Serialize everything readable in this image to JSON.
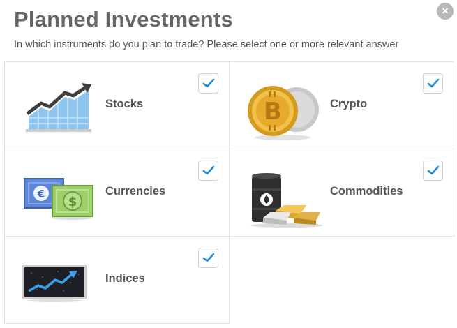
{
  "dialog": {
    "title": "Planned Investments",
    "subtitle": "In which instruments do you plan to trade? Please select one or more relevant answer",
    "close_label": "×"
  },
  "options": [
    {
      "label": "Stocks",
      "icon": "stocks-chart-icon",
      "checked": true
    },
    {
      "label": "Crypto",
      "icon": "crypto-coins-icon",
      "checked": true
    },
    {
      "label": "Currencies",
      "icon": "currency-bills-icon",
      "checked": true
    },
    {
      "label": "Commodities",
      "icon": "oil-gold-icon",
      "checked": true
    },
    {
      "label": "Indices",
      "icon": "index-screen-icon",
      "checked": true
    }
  ],
  "colors": {
    "check": "#1f8bd8",
    "title": "#666666",
    "border": "#e3e3e3"
  }
}
